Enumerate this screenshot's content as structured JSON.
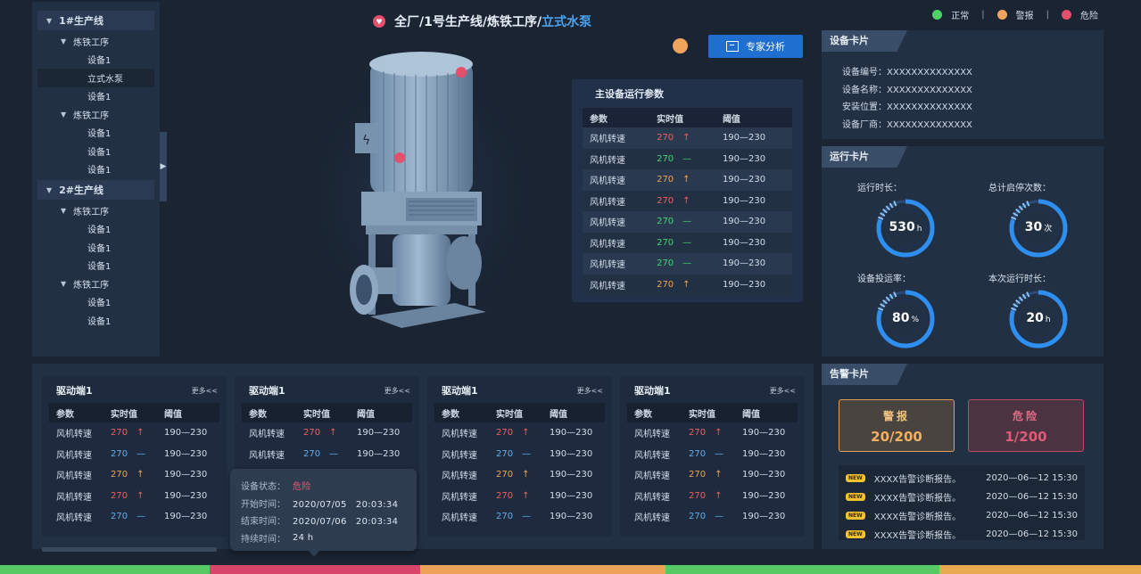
{
  "tree": {
    "items": [
      {
        "level": 0,
        "label": "1#生产线",
        "expanded": true
      },
      {
        "level": 1,
        "label": "炼铁工序",
        "expanded": true
      },
      {
        "level": 2,
        "label": "设备1"
      },
      {
        "level": 2,
        "label": "立式水泵",
        "selected": true
      },
      {
        "level": 2,
        "label": "设备1"
      },
      {
        "level": 1,
        "label": "炼铁工序",
        "expanded": true
      },
      {
        "level": 2,
        "label": "设备1"
      },
      {
        "level": 2,
        "label": "设备1"
      },
      {
        "level": 2,
        "label": "设备1"
      },
      {
        "level": 0,
        "label": "2#生产线",
        "expanded": true
      },
      {
        "level": 1,
        "label": "炼铁工序",
        "expanded": true
      },
      {
        "level": 2,
        "label": "设备1"
      },
      {
        "level": 2,
        "label": "设备1"
      },
      {
        "level": 2,
        "label": "设备1"
      },
      {
        "level": 1,
        "label": "炼铁工序",
        "expanded": true
      },
      {
        "level": 2,
        "label": "设备1"
      },
      {
        "level": 2,
        "label": "设备1"
      }
    ]
  },
  "breadcrumb": {
    "path": "全厂/1号生产线/炼铁工序/",
    "current": "立式水泵"
  },
  "legend": {
    "normal": "正常",
    "warning": "警报",
    "danger": "危险",
    "sep": "|",
    "colors": {
      "normal": "#4fd16a",
      "warning": "#f0a45c",
      "danger": "#e2506c"
    }
  },
  "expert_button": "专家分析",
  "main_params": {
    "title": "主设备运行参数",
    "headers": [
      "参数",
      "实时值",
      "阈值"
    ],
    "rows": [
      {
        "name": "风机转速",
        "value": "270",
        "status": "red",
        "trend": "↑",
        "threshold": "190—230"
      },
      {
        "name": "风机转速",
        "value": "270",
        "status": "green",
        "trend": "—",
        "threshold": "190—230"
      },
      {
        "name": "风机转速",
        "value": "270",
        "status": "orange",
        "trend": "↑",
        "threshold": "190—230"
      },
      {
        "name": "风机转速",
        "value": "270",
        "status": "red",
        "trend": "↑",
        "threshold": "190—230"
      },
      {
        "name": "风机转速",
        "value": "270",
        "status": "green",
        "trend": "—",
        "threshold": "190—230"
      },
      {
        "name": "风机转速",
        "value": "270",
        "status": "green",
        "trend": "—",
        "threshold": "190—230"
      },
      {
        "name": "风机转速",
        "value": "270",
        "status": "green",
        "trend": "—",
        "threshold": "190—230"
      },
      {
        "name": "风机转速",
        "value": "270",
        "status": "orange",
        "trend": "↑",
        "threshold": "190—230"
      }
    ]
  },
  "device_card": {
    "title": "设备卡片",
    "rows": [
      {
        "label": "设备编号：",
        "value": "XXXXXXXXXXXXXX"
      },
      {
        "label": "设备名称：",
        "value": "XXXXXXXXXXXXXX"
      },
      {
        "label": "安装位置：",
        "value": "XXXXXXXXXXXXXX"
      },
      {
        "label": "设备厂商：",
        "value": "XXXXXXXXXXXXXX"
      }
    ]
  },
  "run_card": {
    "title": "运行卡片",
    "gauges": [
      {
        "label": "运行时长：",
        "value": "530",
        "unit": "h",
        "fraction": 0.8
      },
      {
        "label": "总计启停次数：",
        "value": "30",
        "unit": "次",
        "fraction": 0.8
      },
      {
        "label": "设备投运率：",
        "value": "80",
        "unit": "%",
        "fraction": 0.8
      },
      {
        "label": "本次运行时长：",
        "value": "20",
        "unit": "h",
        "fraction": 0.8
      }
    ]
  },
  "alarm_card": {
    "title": "告警卡片",
    "warning": {
      "label": "警报",
      "count": "20/200"
    },
    "danger": {
      "label": "危险",
      "count": "1/200"
    },
    "badge": "NEW",
    "items": [
      {
        "text": "XXXX告警诊断报告。",
        "time": "2020—06—12 15:30"
      },
      {
        "text": "XXXX告警诊断报告。",
        "time": "2020—06—12 15:30"
      },
      {
        "text": "XXXX告警诊断报告。",
        "time": "2020—06—12 15:30"
      },
      {
        "text": "XXXX告警诊断报告。",
        "time": "2020—06—12 15:30"
      }
    ]
  },
  "drivers": {
    "more": "更多<<",
    "headers": [
      "参数",
      "实时值",
      "阈值"
    ],
    "cards": [
      {
        "title": "驱动端1",
        "rows": [
          {
            "name": "风机转速",
            "value": "270",
            "status": "red",
            "trend": "↑",
            "threshold": "190—230"
          },
          {
            "name": "风机转速",
            "value": "270",
            "status": "blue",
            "trend": "—",
            "threshold": "190—230"
          },
          {
            "name": "风机转速",
            "value": "270",
            "status": "orange",
            "trend": "↑",
            "threshold": "190—230"
          },
          {
            "name": "风机转速",
            "value": "270",
            "status": "red",
            "trend": "↑",
            "threshold": "190—230"
          },
          {
            "name": "风机转速",
            "value": "270",
            "status": "blue",
            "trend": "—",
            "threshold": "190—230"
          }
        ]
      },
      {
        "title": "驱动端1",
        "rows": [
          {
            "name": "风机转速",
            "value": "270",
            "status": "red",
            "trend": "↑",
            "threshold": "190—230"
          },
          {
            "name": "风机转速",
            "value": "270",
            "status": "blue",
            "trend": "—",
            "threshold": "190—230"
          }
        ]
      },
      {
        "title": "驱动端1",
        "rows": [
          {
            "name": "风机转速",
            "value": "270",
            "status": "red",
            "trend": "↑",
            "threshold": "190—230"
          },
          {
            "name": "风机转速",
            "value": "270",
            "status": "blue",
            "trend": "—",
            "threshold": "190—230"
          },
          {
            "name": "风机转速",
            "value": "270",
            "status": "orange",
            "trend": "↑",
            "threshold": "190—230"
          },
          {
            "name": "风机转速",
            "value": "270",
            "status": "red",
            "trend": "↑",
            "threshold": "190—230"
          },
          {
            "name": "风机转速",
            "value": "270",
            "status": "blue",
            "trend": "—",
            "threshold": "190—230"
          }
        ]
      },
      {
        "title": "驱动端1",
        "rows": [
          {
            "name": "风机转速",
            "value": "270",
            "status": "red",
            "trend": "↑",
            "threshold": "190—230"
          },
          {
            "name": "风机转速",
            "value": "270",
            "status": "blue",
            "trend": "—",
            "threshold": "190—230"
          },
          {
            "name": "风机转速",
            "value": "270",
            "status": "orange",
            "trend": "↑",
            "threshold": "190—230"
          },
          {
            "name": "风机转速",
            "value": "270",
            "status": "red",
            "trend": "↑",
            "threshold": "190—230"
          },
          {
            "name": "风机转速",
            "value": "270",
            "status": "blue",
            "trend": "—",
            "threshold": "190—230"
          }
        ]
      }
    ]
  },
  "tooltip": {
    "rows": [
      {
        "label": "设备状态：",
        "value": "危险",
        "danger": true
      },
      {
        "label": "开始时间：",
        "value": "2020/07/05　20:03:34"
      },
      {
        "label": "结束时间：",
        "value": "2020/07/06　20:03:34"
      },
      {
        "label": "持续时间：",
        "value": "24 h"
      }
    ]
  },
  "statusbar": [
    {
      "color": "#56c965",
      "share": 0.184
    },
    {
      "color": "#d9456a",
      "share": 0.184
    },
    {
      "color": "#eda357",
      "share": 0.215
    },
    {
      "color": "#56c965",
      "share": 0.24
    },
    {
      "color": "#e9a94f",
      "share": 0.177
    }
  ]
}
